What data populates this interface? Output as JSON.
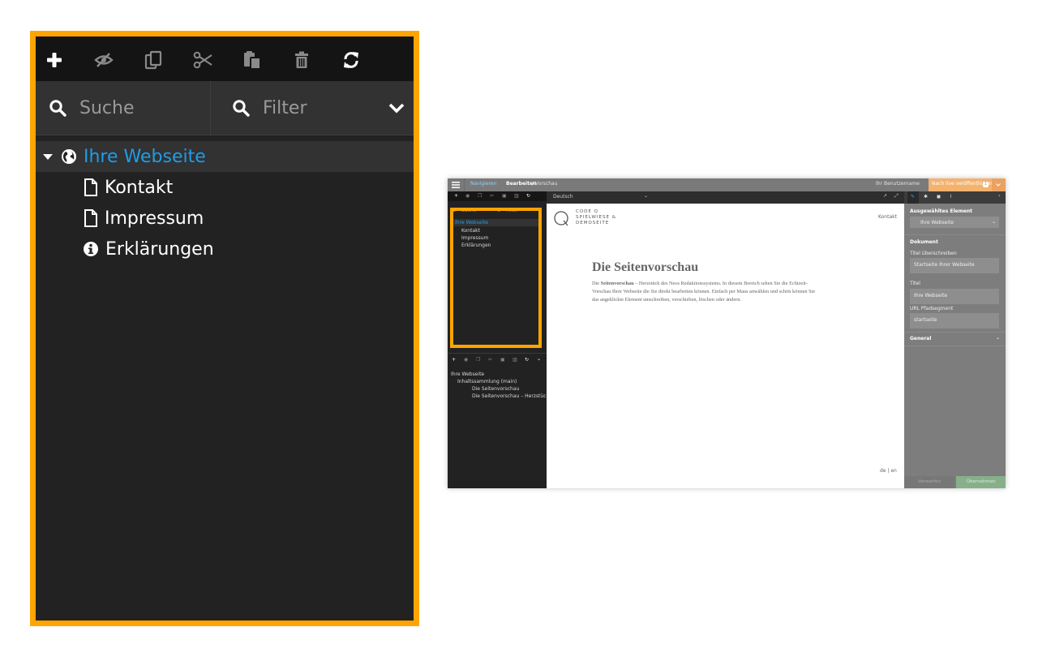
{
  "zoom_panel": {
    "toolbar": {
      "icons": [
        "plus-icon",
        "eye-slash-icon",
        "copy-icon",
        "cut-icon",
        "paste-icon",
        "trash-icon",
        "refresh-icon"
      ]
    },
    "search": {
      "label": "Suche"
    },
    "filter": {
      "label": "Filter"
    },
    "tree": {
      "root": {
        "label": "Ihre Webseite"
      },
      "children": [
        {
          "label": "Kontakt",
          "icon": "file-icon"
        },
        {
          "label": "Impressum",
          "icon": "file-icon"
        },
        {
          "label": "Erklärungen",
          "icon": "info-circle-icon"
        }
      ]
    }
  },
  "mini_app": {
    "topbar": {
      "navigate": "Navigieren",
      "edit": "Bearbeiten",
      "preview": "/ Vorschau",
      "user": "Ihr Benutzername",
      "publish": "Nach live veröffentlichen",
      "publish_count": "1"
    },
    "page_tree": {
      "search": "Suche",
      "filter": "Filter",
      "root": "Ihre Webseite",
      "children": [
        "Kontakt",
        "Impressum",
        "Erklärungen"
      ]
    },
    "content_tree": {
      "root": "Ihre Webseite",
      "collection": "Inhaltssammlung (main)",
      "items": [
        "Die Seitenvorschau",
        "Die Seitenvorschau – Herzstück de..."
      ]
    },
    "edit_bar": {
      "language": "Deutsch"
    },
    "canvas": {
      "logo": [
        "CODE Q",
        "SPIELWIESE &",
        "DEMOSEITE"
      ],
      "nav_link": "Kontakt",
      "headline": "Die Seitenvorschau",
      "body_strong": "Seitenvorschau",
      "body_lines": [
        "Die ",
        " – Herzstück des Neos Redaktionssystems. In diesem Bereich sehen Sie die Echtzeit-",
        "Vorschau Ihrer Webseite die Sie direkt bearbeiten können. Einfach per Maus anwählen und schön können Sie",
        "das angeklickte Element umschreiben, verschieben, löschen oder ändern."
      ],
      "lang_switch": "de | en"
    },
    "inspector": {
      "selected_label": "Ausgewähltes Element",
      "selected_value": "Ihre Webseite",
      "section_document": "Dokument",
      "title_override_label": "Titel überschreiben",
      "title_override_value": "Startseite Ihrer Webseite",
      "title_label": "Titel",
      "title_value": "Ihre Webseite",
      "url_label": "URL Pfadsegment",
      "url_value": "startseite",
      "section_general": "General",
      "discard": "Verwerfen",
      "apply": "Übernehmen"
    }
  }
}
